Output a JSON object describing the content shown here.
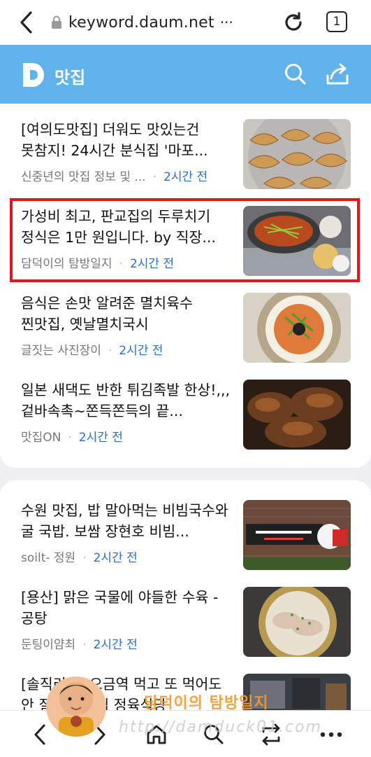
{
  "browser": {
    "url": "keyword.daum.net",
    "url_more": "···",
    "tab_count": "1"
  },
  "header": {
    "logo_letter": "D",
    "title": "맛집"
  },
  "articles": [
    {
      "title": "[여의도맛집] 더워도 맛있는건 못참지! 24시간 분식집 '마포...",
      "source": "신중년의 맛집 정보 및 ...",
      "time": "2시간 전",
      "thumb": "dumplings-photo"
    },
    {
      "title": "가성비 최고, 판교집의 두루치기 정식은 1만 원입니다. by 직장...",
      "source": "담덕이의 탐방일지",
      "time": "2시간 전",
      "thumb": "duruchigi-set-photo",
      "highlighted": true
    },
    {
      "title": "음식은 손맛 알려준 멸치육수 찐맛집, 옛날멸치국시",
      "source": "글짓는 사진장이",
      "time": "2시간 전",
      "thumb": "bibim-noodle-photo"
    },
    {
      "title": "일본 새댁도 반한 튀김족발 한상!,,,겉바속촉~쫀득쫀득의 끝...",
      "source": "맛집ON",
      "time": "2시간 전",
      "thumb": "fried-jokbal-photo"
    },
    {
      "title": "수원 맛집, 밥 말아먹는 비빔국수와 굴 국밥. 보쌈 장현호 비빔...",
      "source": "soilt- 정원",
      "time": "2시간 전",
      "thumb": "restaurant-sign-photo"
    },
    {
      "title": "[용산] 맑은 국물에 야들한 수육 -공탕",
      "source": "둔팅이얌최",
      "time": "2시간 전",
      "thumb": "gomtang-photo"
    },
    {
      "title": "[솔직리뷰] 오금역 먹고 또 먹어도 안 질리는 맛집 정육식당",
      "source": "",
      "time": "",
      "thumb": "table-photo"
    }
  ],
  "watermark": {
    "title": "담덕이의 탐방일지",
    "url": "http://damduck01.com"
  },
  "nav": {
    "items": [
      "back-icon",
      "forward-icon",
      "home-icon",
      "search-icon",
      "tabs-icon",
      "more-icon"
    ]
  },
  "colors": {
    "header_bg": "#5fb3ea",
    "time_text": "#2a6fd1",
    "highlight_border": "#e8141c",
    "watermark_title": "#f39a2c"
  }
}
